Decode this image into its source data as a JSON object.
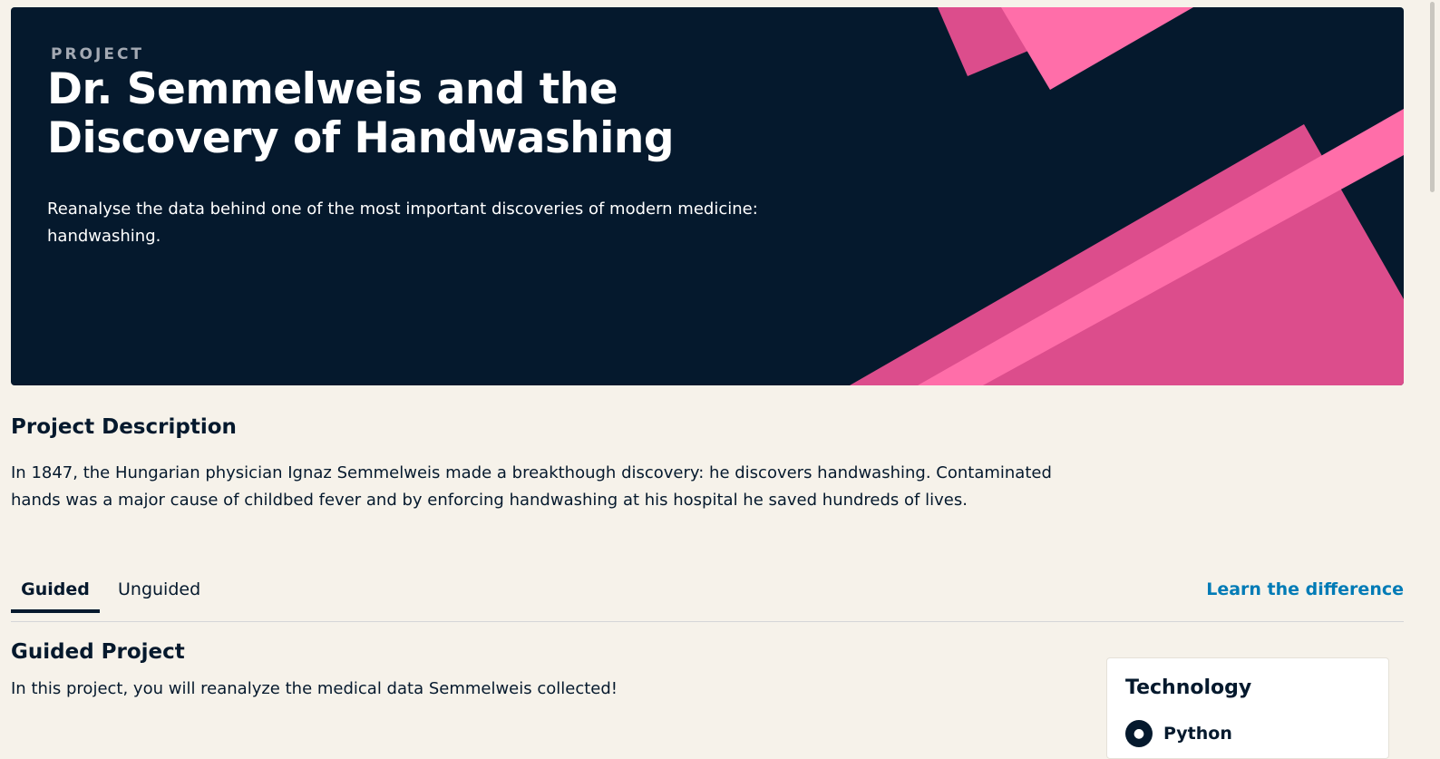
{
  "hero": {
    "eyebrow": "PROJECT",
    "title": "Dr. Semmelweis and the Discovery of Handwashing",
    "description": "Reanalyse the data behind one of the most important discoveries of modern medicine: handwashing.",
    "colors": {
      "background": "#05192d",
      "pink_light": "#ff6ea9",
      "pink_dark": "#dc4d8c"
    }
  },
  "description_section": {
    "title": "Project Description",
    "text": "In 1847, the Hungarian physician Ignaz Semmelweis made a breakthough discovery: he discovers handwashing. Contaminated hands was a major cause of childbed fever and by enforcing handwashing at his hospital he saved hundreds of lives."
  },
  "tabs": {
    "items": [
      {
        "label": "Guided",
        "active": true
      },
      {
        "label": "Unguided",
        "active": false
      }
    ],
    "learn_link": "Learn the difference"
  },
  "guided": {
    "title": "Guided Project",
    "text": "In this project, you will reanalyze the medical data Semmelweis collected!"
  },
  "technology": {
    "title": "Technology",
    "item": "Python",
    "icon": "python-icon"
  }
}
